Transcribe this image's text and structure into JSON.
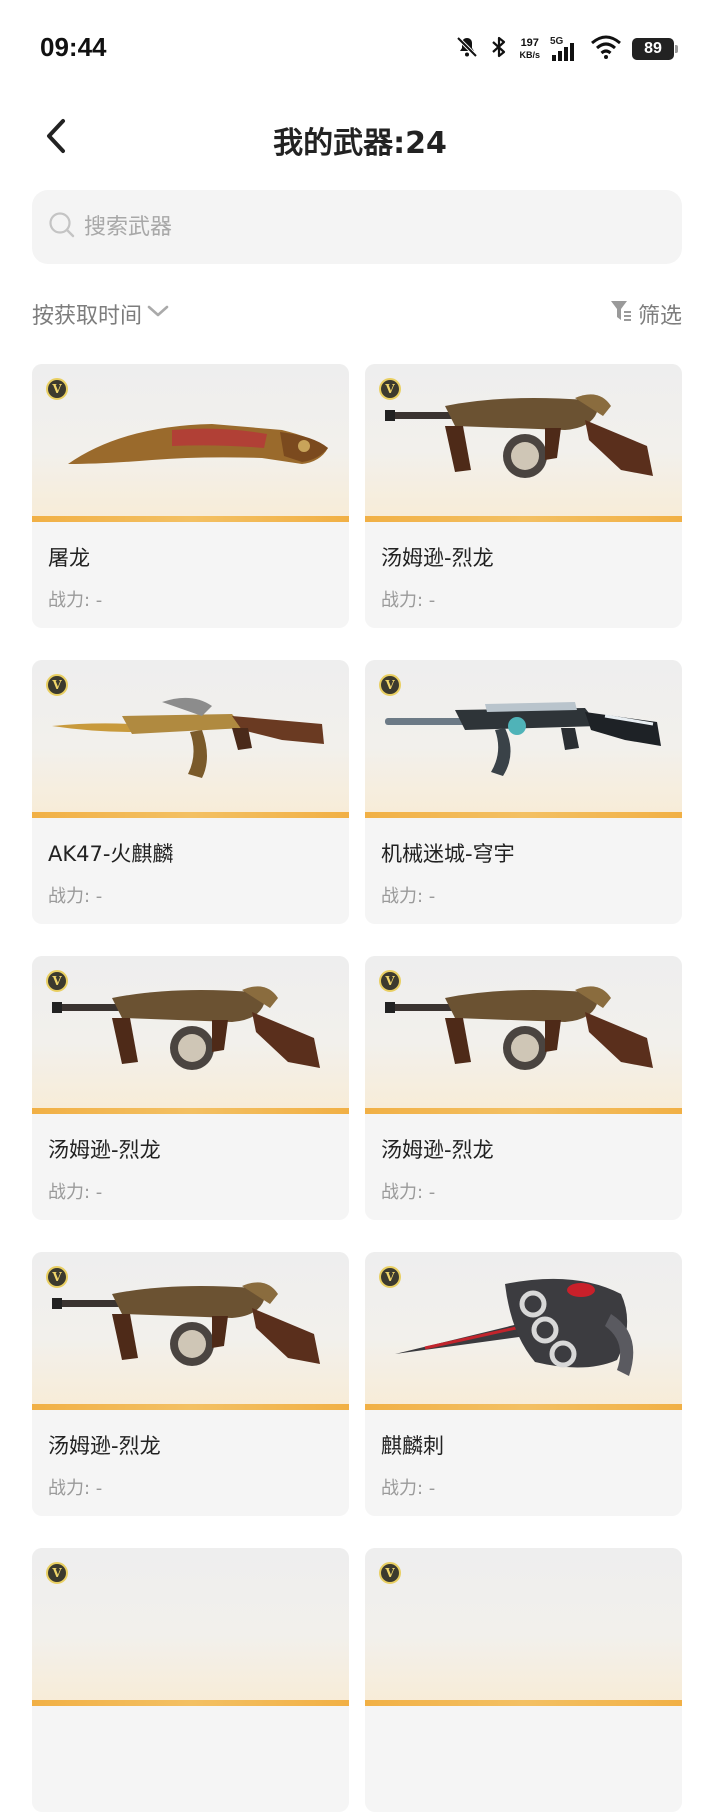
{
  "status_bar": {
    "time": "09:44",
    "net_speed_value": "197",
    "net_speed_unit": "KB/s",
    "network_type": "5G",
    "battery": "89"
  },
  "header": {
    "title": "我的武器:24"
  },
  "search": {
    "placeholder": "搜索武器",
    "value": ""
  },
  "sort": {
    "label": "按获取时间"
  },
  "filter": {
    "label": "筛选"
  },
  "badge_letter": "V",
  "weapons": [
    {
      "name": "屠龙",
      "power": "战力: -",
      "icon": "kukri-knife-icon"
    },
    {
      "name": "汤姆逊-烈龙",
      "power": "战力: -",
      "icon": "tommy-gun-icon"
    },
    {
      "name": "AK47-火麒麟",
      "power": "战力: -",
      "icon": "assault-rifle-icon"
    },
    {
      "name": "机械迷城-穹宇",
      "power": "战力: -",
      "icon": "assault-rifle-icon"
    },
    {
      "name": "汤姆逊-烈龙",
      "power": "战力: -",
      "icon": "tommy-gun-icon"
    },
    {
      "name": "汤姆逊-烈龙",
      "power": "战力: -",
      "icon": "tommy-gun-icon"
    },
    {
      "name": "汤姆逊-烈龙",
      "power": "战力: -",
      "icon": "tommy-gun-icon"
    },
    {
      "name": "麒麟刺",
      "power": "战力: -",
      "icon": "knuckle-dagger-icon"
    }
  ],
  "colors": {
    "accent_bar": "#f1b045",
    "card_bg": "#f5f5f5",
    "muted_text": "#9a9a9a"
  }
}
